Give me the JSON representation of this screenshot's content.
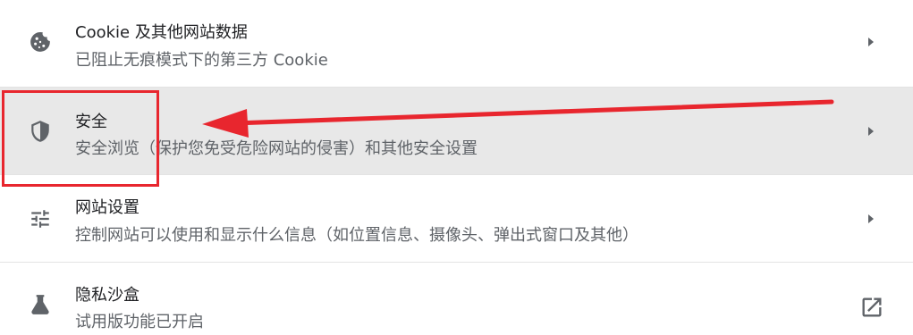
{
  "settings_rows": [
    {
      "title": "Cookie 及其他网站数据",
      "subtitle": "已阻止无痕模式下的第三方 Cookie",
      "icon": "cookie-icon",
      "trailing": "chevron-right-icon"
    },
    {
      "title": "安全",
      "subtitle": "安全浏览（保护您免受危险网站的侵害）和其他安全设置",
      "icon": "shield-icon",
      "trailing": "chevron-right-icon"
    },
    {
      "title": "网站设置",
      "subtitle": "控制网站可以使用和显示什么信息（如位置信息、摄像头、弹出式窗口及其他）",
      "icon": "tune-sliders-icon",
      "trailing": "chevron-right-icon"
    },
    {
      "title": "隐私沙盒",
      "subtitle": "试用版功能已开启",
      "icon": "flask-icon",
      "trailing": "open-in-new-icon"
    }
  ],
  "colors": {
    "annotation": "#e8262e",
    "hover_row": "#e8e8e8",
    "title_text": "#202124",
    "subtitle_text": "#5f6368",
    "icon": "#5f6368"
  }
}
